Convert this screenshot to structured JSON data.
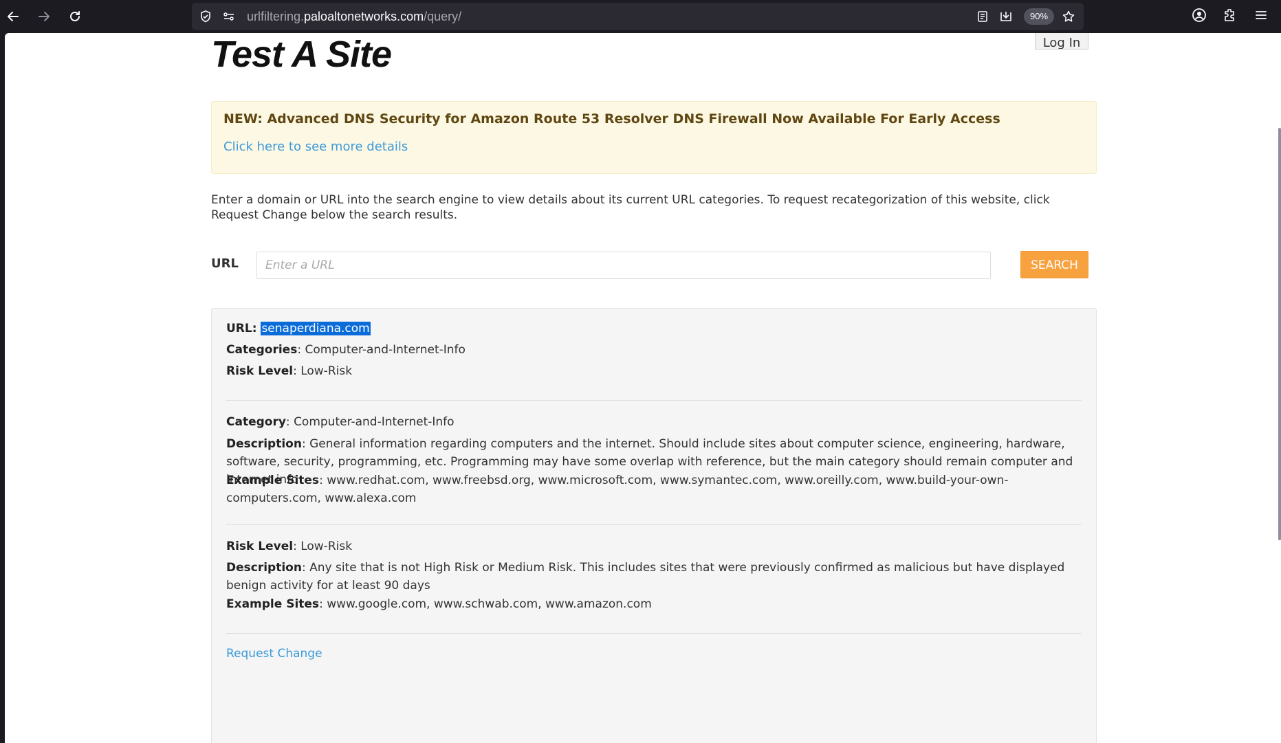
{
  "browser": {
    "url_prefix": "urlfiltering.",
    "url_host": "paloaltonetworks.com",
    "url_path": "/query/",
    "zoom": "90%"
  },
  "page": {
    "title": "Test A Site",
    "login_label": "Log In",
    "banner_title": "NEW: Advanced DNS Security for Amazon Route 53 Resolver DNS Firewall Now Available For Early Access",
    "banner_link": "Click here to see more details",
    "intro": "Enter a domain or URL into the search engine to view details about its current URL categories. To request recategorization of this website, click Request Change below the search results.",
    "url_label": "URL",
    "url_placeholder": "Enter a URL",
    "search_label": "SEARCH"
  },
  "result": {
    "url_key": "URL",
    "url_value": "senaperdiana.com",
    "categories_key": "Categories",
    "categories_value": "Computer-and-Internet-Info",
    "risk_key": "Risk Level",
    "risk_value": "Low-Risk",
    "category_block": {
      "category_key": "Category",
      "category_value": "Computer-and-Internet-Info",
      "description_key": "Description",
      "description_value": "General information regarding computers and the internet. Should include sites about computer science, engineering, hardware, software, security, programming, etc. Programming may have some overlap with reference, but the main category should remain computer and internet info",
      "examples_key": "Example Sites",
      "examples_value": "www.redhat.com, www.freebsd.org, www.microsoft.com, www.symantec.com, www.oreilly.com, www.build-your-own-computers.com, www.alexa.com"
    },
    "risk_block": {
      "risk_key": "Risk Level",
      "risk_value": "Low-Risk",
      "description_key": "Description",
      "description_value": "Any site that is not High Risk or Medium Risk. This includes sites that were previously confirmed as malicious but have displayed benign activity for at least 90 days",
      "examples_key": "Example Sites",
      "examples_value": "www.google.com, www.schwab.com, www.amazon.com"
    },
    "request_change": "Request Change"
  },
  "colors": {
    "accent_orange": "#f7a13f",
    "link_blue": "#3b9ad9",
    "selection_blue": "#0a6cd8",
    "banner_bg": "#fdf8e4"
  }
}
